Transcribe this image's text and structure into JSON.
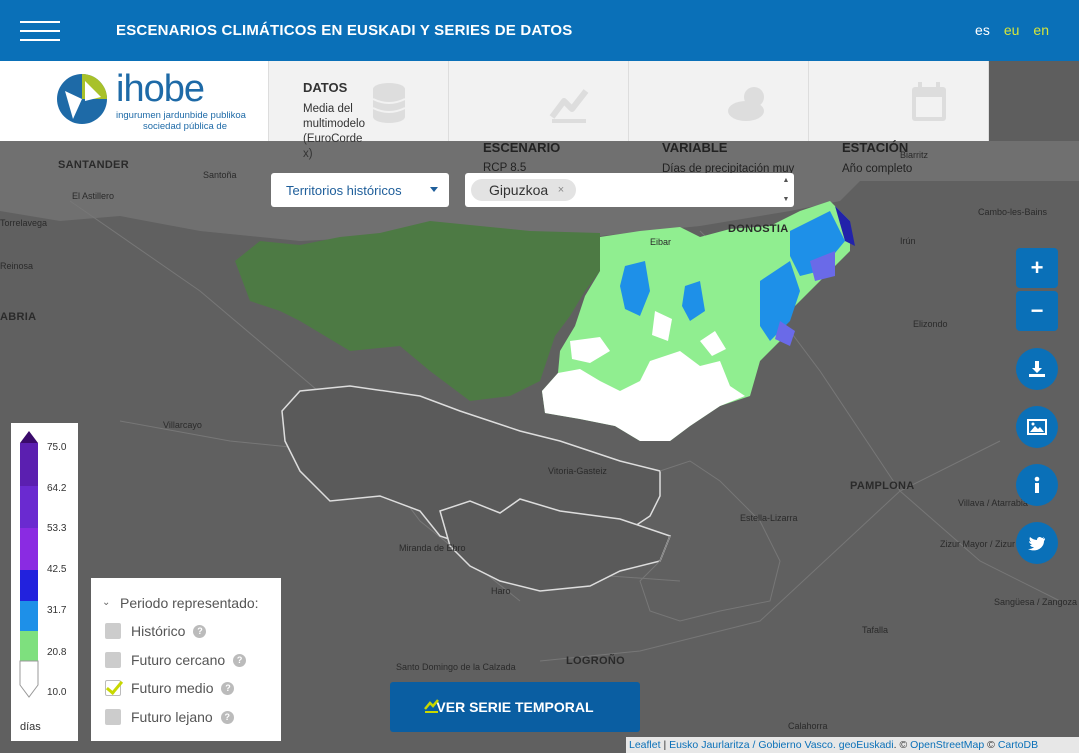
{
  "header": {
    "title": "ESCENARIOS CLIMÁTICOS EN EUSKADI Y SERIES DE DATOS",
    "languages": [
      "es",
      "eu",
      "en"
    ]
  },
  "logo": {
    "word": "ihobe",
    "line1": "ingurumen jardunbide publikoa",
    "line2": "sociedad pública de"
  },
  "panels": [
    {
      "title": "DATOS",
      "text": "Media del multimodelo (EuroCordex)",
      "icon": "database-icon"
    },
    {
      "title": "ESCENARIO",
      "text": "RCP 8.5",
      "icon": "chart-line-icon"
    },
    {
      "title": "VARIABLE",
      "text": "Días de precipitación muy",
      "icon": "cloud-sun-icon"
    },
    {
      "title": "ESTACIÓN",
      "text": "Año completo",
      "icon": "calendar-icon"
    }
  ],
  "filters": {
    "territory_select": "Territorios históricos",
    "selected_chip": "Gipuzkoa",
    "chip_remove": "×"
  },
  "legend": {
    "ticks": [
      "75.0",
      "64.2",
      "53.3",
      "42.5",
      "31.7",
      "20.8",
      "10.0"
    ],
    "unit": "días",
    "colors": [
      "#3a0a6b",
      "#5b1fb0",
      "#8a2be2",
      "#2222dd",
      "#6a6ae8",
      "#1e90e8",
      "#7ee07e",
      "#ffffff"
    ]
  },
  "period": {
    "title": "Periodo representado:",
    "options": [
      {
        "label": "Histórico",
        "checked": false
      },
      {
        "label": "Futuro cercano",
        "checked": false
      },
      {
        "label": "Futuro medio",
        "checked": true
      },
      {
        "label": "Futuro lejano",
        "checked": false
      }
    ]
  },
  "serie_button": "VER SERIE TEMPORAL",
  "controls": {
    "zoom_in": "+",
    "zoom_out": "−"
  },
  "places": [
    {
      "name": "SANTANDER",
      "cls": ""
    },
    {
      "name": "Torrelavega",
      "cls": "small"
    },
    {
      "name": "El Astillero",
      "cls": "small"
    },
    {
      "name": "Santoña",
      "cls": "small"
    },
    {
      "name": "Villarcayo",
      "cls": "small"
    },
    {
      "name": "DONOSTIA",
      "cls": ""
    },
    {
      "name": "Biarritz",
      "cls": "small"
    },
    {
      "name": "Cambo-les-Bains",
      "cls": "small"
    },
    {
      "name": "Elizondo",
      "cls": "small"
    },
    {
      "name": "PAMPLONA",
      "cls": ""
    },
    {
      "name": "Villava / Atarrabia",
      "cls": "small"
    },
    {
      "name": "Zizur Mayor / Zizur Nagusia",
      "cls": "small"
    },
    {
      "name": "Tafalla",
      "cls": "small"
    },
    {
      "name": "Sangüesa / Zangoza",
      "cls": "small"
    },
    {
      "name": "Estella-Lizarra",
      "cls": "small"
    },
    {
      "name": "LOGROÑO",
      "cls": ""
    },
    {
      "name": "Miranda de Ebro",
      "cls": "small"
    },
    {
      "name": "Haro",
      "cls": "small"
    },
    {
      "name": "Santo Domingo de la Calzada",
      "cls": "small"
    },
    {
      "name": "Calahorra",
      "cls": "small"
    },
    {
      "name": "Vitoria-Gasteiz",
      "cls": "small"
    },
    {
      "name": "Eibar",
      "cls": "small"
    },
    {
      "name": "Irún",
      "cls": "small"
    },
    {
      "name": "ABRIA",
      "cls": ""
    },
    {
      "name": "Reinosa",
      "cls": "small"
    }
  ],
  "attribution": {
    "leaflet": "Leaflet",
    "sep": " | ",
    "source": "Eusko Jaurlaritza / Gobierno Vasco. geoEuskadi",
    "osm_prefix": ". © ",
    "osm": "OpenStreetMap",
    "carto_prefix": " © ",
    "carto": "CartoDB"
  }
}
